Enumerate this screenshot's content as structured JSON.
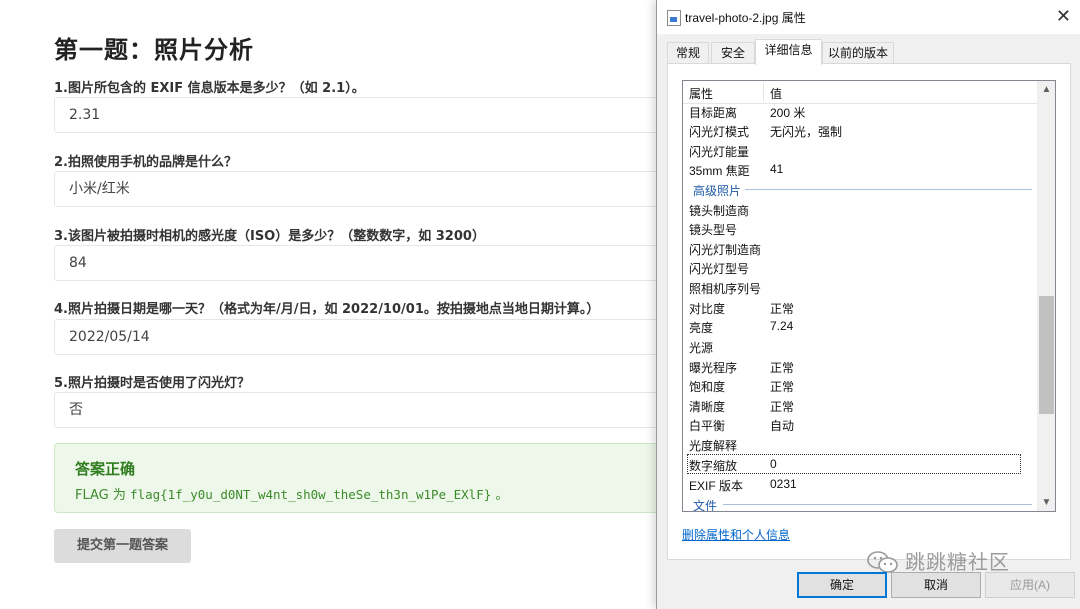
{
  "quiz": {
    "title": "第一题：照片分析",
    "questions": [
      {
        "label": "1.图片所包含的 EXIF 信息版本是多少？（如 2.1）。",
        "answer": "2.31"
      },
      {
        "label": "2.拍照使用手机的品牌是什么？",
        "answer": "小米/红米"
      },
      {
        "label": "3.该图片被拍摄时相机的感光度（ISO）是多少？（整数数字，如 3200）",
        "answer": "84"
      },
      {
        "label": "4.照片拍摄日期是哪一天？（格式为年/月/日，如 2022/10/01。按拍摄地点当地日期计算。）",
        "answer": "2022/05/14"
      },
      {
        "label": "5.照片拍摄时是否使用了闪光灯？",
        "answer": "否"
      }
    ],
    "result": {
      "title": "答案正确",
      "prefix": "FLAG 为 ",
      "flag": "flag{1f_y0u_d0NT_w4nt_sh0w_theSe_th3n_w1Pe_EXlF}",
      "suffix": " 。"
    },
    "submit_label": "提交第一题答案"
  },
  "dialog": {
    "title": "travel-photo-2.jpg 属性",
    "close_glyph": "✕",
    "tabs": [
      "常规",
      "安全",
      "详细信息",
      "以前的版本"
    ],
    "active_tab": "详细信息",
    "list": {
      "col_property": "属性",
      "col_value": "值",
      "rows_top": [
        {
          "k": "目标距离",
          "v": "200 米"
        },
        {
          "k": "闪光灯模式",
          "v": "无闪光，强制"
        },
        {
          "k": "闪光灯能量",
          "v": ""
        },
        {
          "k": "35mm 焦距",
          "v": "41"
        }
      ],
      "group_advanced": "高级照片",
      "rows_advanced": [
        {
          "k": "镜头制造商",
          "v": ""
        },
        {
          "k": "镜头型号",
          "v": ""
        },
        {
          "k": "闪光灯制造商",
          "v": ""
        },
        {
          "k": "闪光灯型号",
          "v": ""
        },
        {
          "k": "照相机序列号",
          "v": ""
        },
        {
          "k": "对比度",
          "v": "正常"
        },
        {
          "k": "亮度",
          "v": "7.24"
        },
        {
          "k": "光源",
          "v": ""
        },
        {
          "k": "曝光程序",
          "v": "正常"
        },
        {
          "k": "饱和度",
          "v": "正常"
        },
        {
          "k": "清晰度",
          "v": "正常"
        },
        {
          "k": "白平衡",
          "v": "自动"
        },
        {
          "k": "光度解释",
          "v": ""
        },
        {
          "k": "数字缩放",
          "v": "0"
        },
        {
          "k": "EXIF 版本",
          "v": "0231"
        }
      ],
      "group_file": "文件",
      "selected_row": "数字缩放",
      "scroll_up_glyph": "▲",
      "scroll_down_glyph": "▼"
    },
    "remove_link": "删除属性和个人信息",
    "buttons": {
      "ok": "确定",
      "cancel": "取消",
      "apply": "应用(A)"
    },
    "apply_enabled": false
  },
  "watermark": {
    "icon": "wechat-icon",
    "text": "跳跳糖社区"
  }
}
